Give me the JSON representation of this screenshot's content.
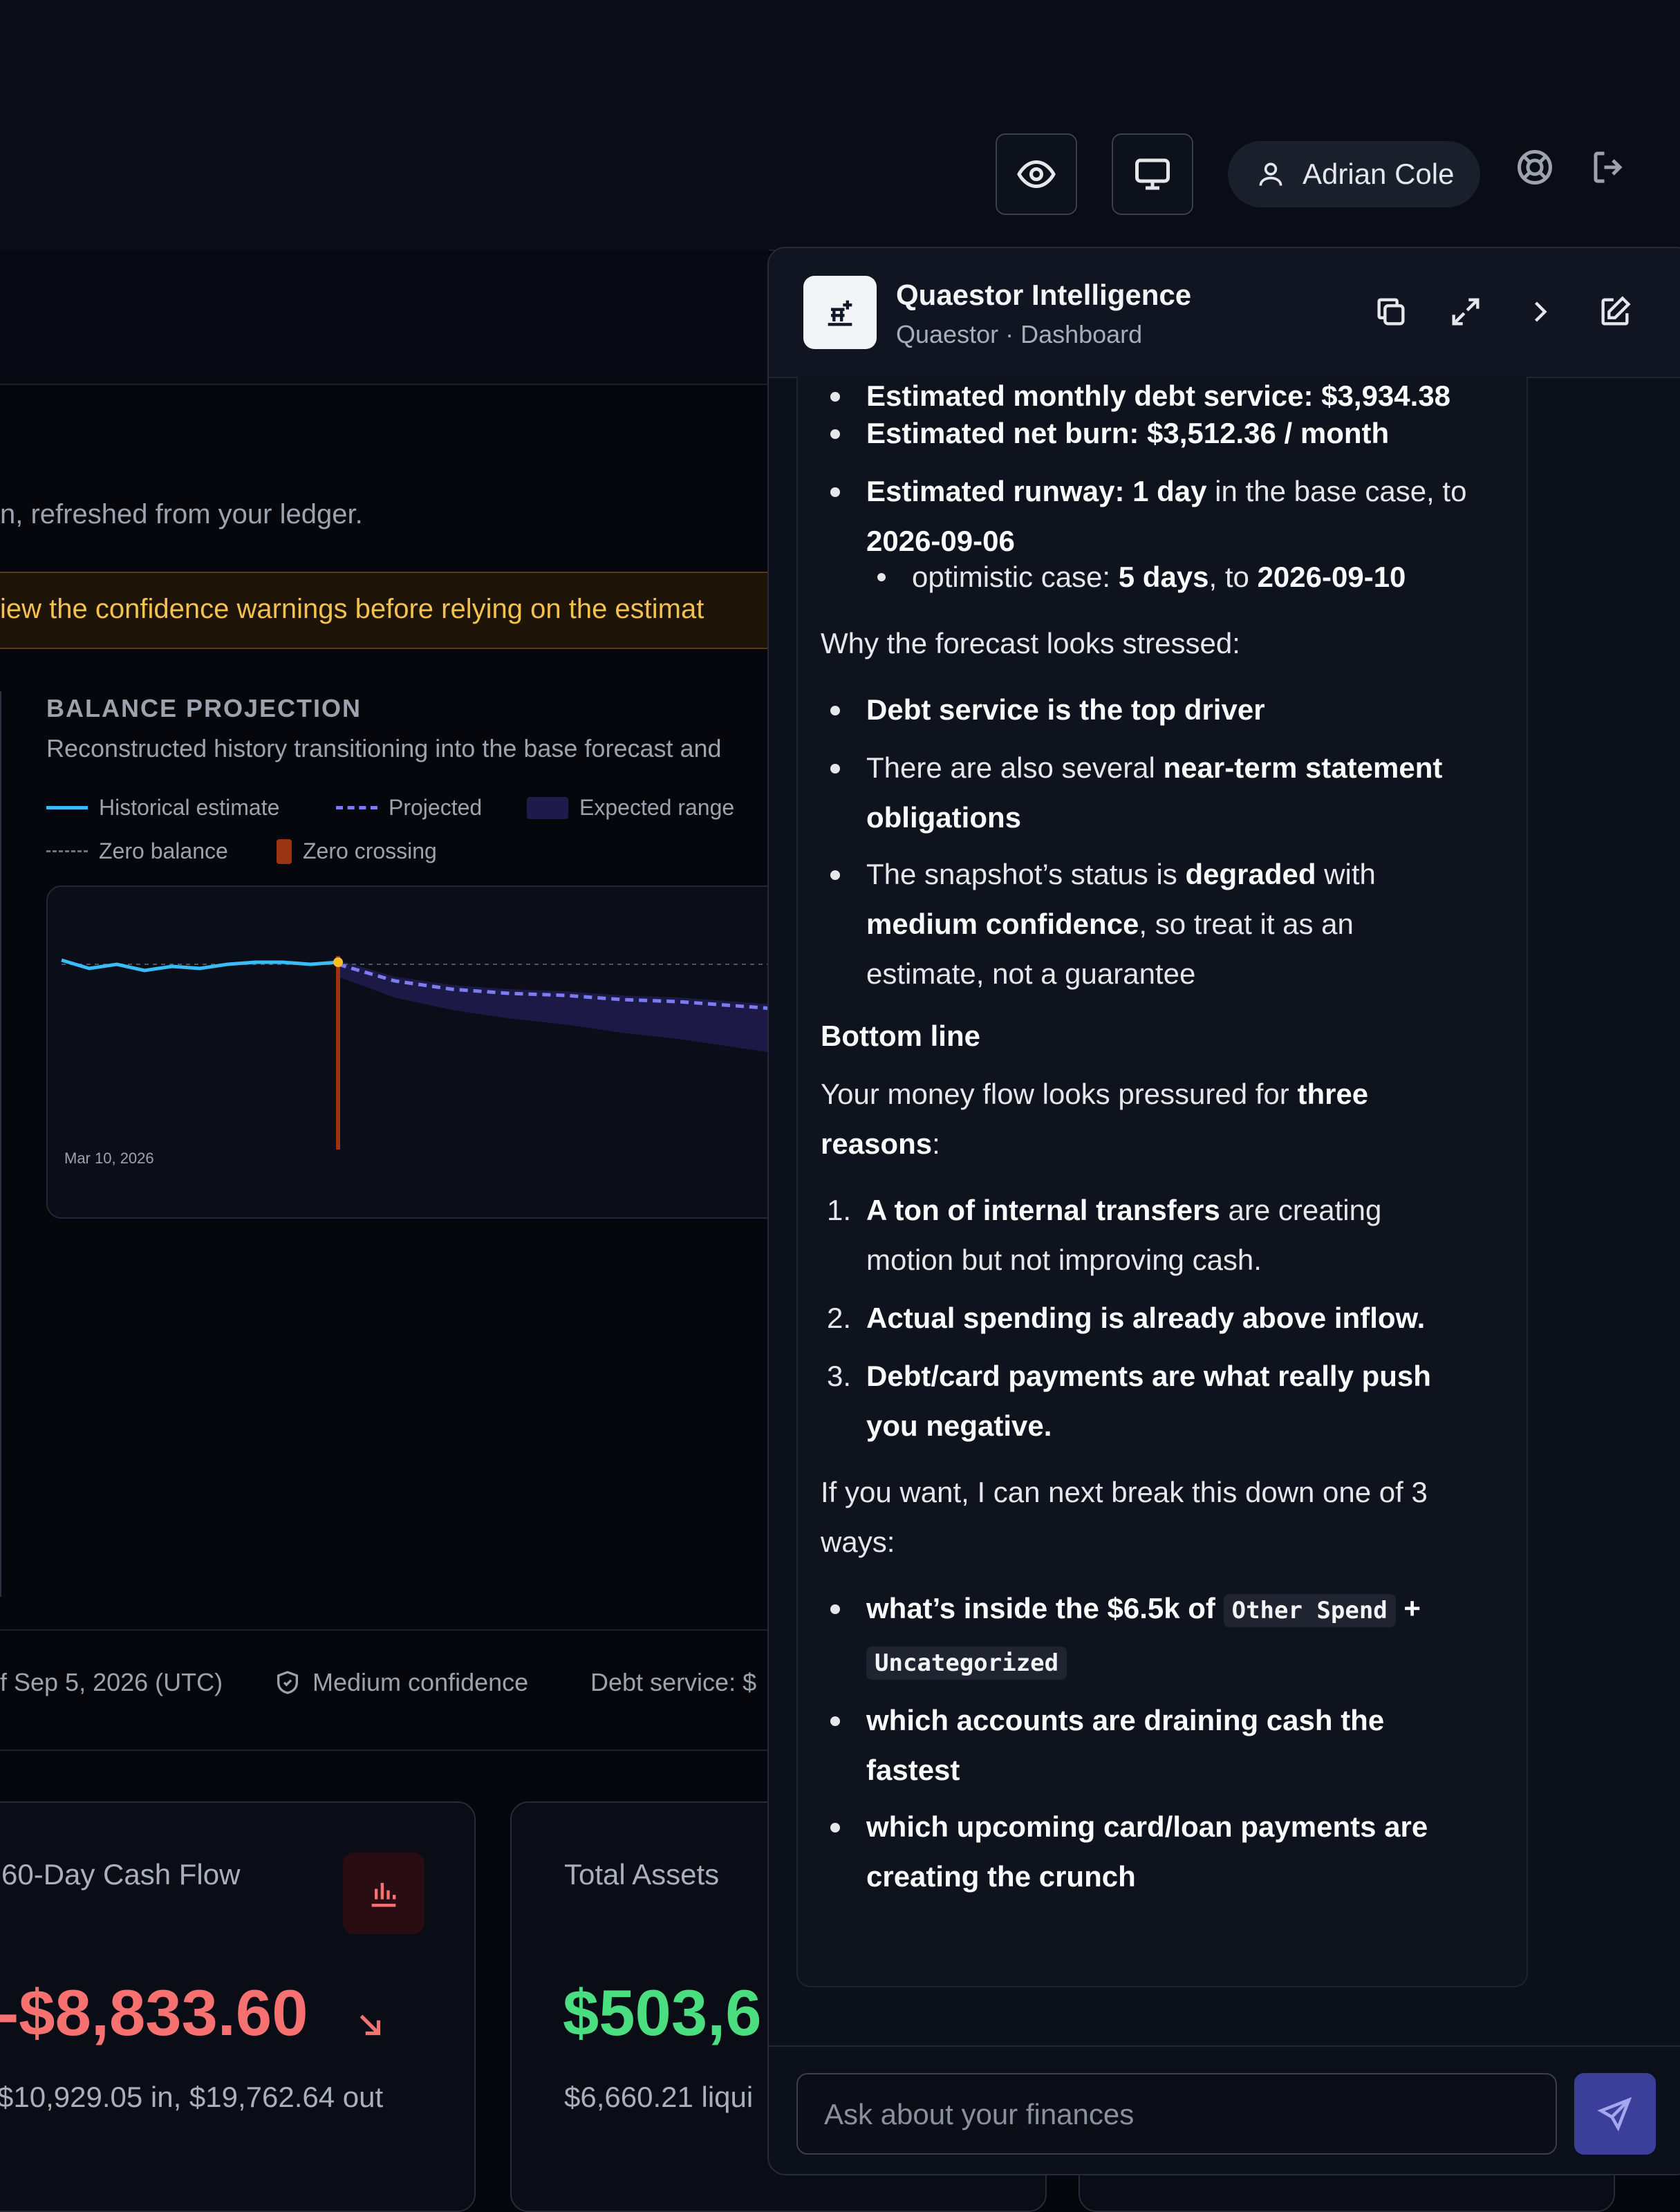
{
  "topbar": {
    "user_name": "Adrian Cole",
    "icons": [
      "eye-icon",
      "monitor-icon",
      "user-icon",
      "help-lifebuoy-icon",
      "logout-icon"
    ]
  },
  "dashboard": {
    "subtitle": "n, refreshed from your ledger.",
    "warning": "iew the confidence warnings before relying on the estimat",
    "chart": {
      "title": "BALANCE PROJECTION",
      "subtitle": "Reconstructed history transitioning into the base forecast and",
      "legend": {
        "historical": "Historical estimate",
        "projected": "Projected",
        "range": "Expected range",
        "zero": "Zero balance",
        "crossing": "Zero crossing"
      },
      "x_tick": "Mar 10, 2026"
    },
    "status": {
      "date": "f Sep 5, 2026 (UTC)",
      "confidence": "Medium confidence",
      "debt": "Debt service: $"
    },
    "cards": [
      {
        "title": "60-Day Cash Flow",
        "value": "-$8,833.60",
        "detail": "$10,929.05 in, $19,762.64 out"
      },
      {
        "title": "Total Assets",
        "value": "$503,6",
        "detail": "$6,660.21 liqui"
      }
    ]
  },
  "chart_data": {
    "type": "line",
    "title": "BALANCE PROJECTION",
    "x_tick_labels": [
      "Mar 10, 2026"
    ],
    "series": [
      {
        "name": "Historical estimate",
        "values": [
          1.0,
          0.96,
          0.98,
          0.95,
          0.97,
          0.96,
          0.98,
          0.99,
          0.99,
          0.98,
          0.99
        ]
      },
      {
        "name": "Projected",
        "values": [
          0.98,
          0.9,
          0.86,
          0.84,
          0.83,
          0.81,
          0.8,
          0.78,
          0.76,
          0.74,
          0.72
        ]
      }
    ],
    "colors": {
      "historical": "#38bdf8",
      "projected": "#7c7cf0",
      "range": "#1e1b4b",
      "crossing": "#9a3412"
    }
  },
  "chat": {
    "title": "Quaestor Intelligence",
    "context": "Quaestor · Dashboard",
    "lines": {
      "b1": "Estimated monthly debt service: $3,934.38",
      "b2": "Estimated net burn: $3,512.36 / month",
      "b3_label": "Estimated runway:",
      "b3_days": "1 day",
      "b3_mid": " in the base case, to",
      "b3_date": "2026-09-06",
      "sub_pre": "optimistic case: ",
      "sub_days": "5 days",
      "sub_mid": ", to ",
      "sub_date": "2026-09-10",
      "why": "Why the forecast looks stressed:",
      "w1": "Debt service is the top driver",
      "w2_pre": "There are also several ",
      "w2_bold1": "near-term statement",
      "w2_bold2": "obligations",
      "w3_pre": "The snapshot’s status is ",
      "w3_bold": "degraded",
      "w3_post": " with",
      "w3_bold2": "medium confidence",
      "w3_post2": ", so treat it as an",
      "w3_line3": "estimate, not a guarantee",
      "bottom": "Bottom line",
      "reasons_pre": "Your money flow looks pressured for ",
      "reasons_bold1": "three",
      "reasons_bold2": "reasons",
      "reasons_post": ":",
      "r1_bold": "A ton of internal transfers",
      "r1_post": " are creating",
      "r1_line2": "motion but not improving cash.",
      "r2": "Actual spending is already above inflow.",
      "r3_l1": "Debt/card payments are what really push",
      "r3_l2": "you negative.",
      "next_l1": "If you want, I can next break this down one of 3",
      "next_l2": "ways:",
      "o1_pre": "what’s inside the $6.5k of ",
      "o1_code1": "Other Spend",
      "o1_plus": " +",
      "o1_code2": "Uncategorized",
      "o2_l1": "which accounts are draining cash the",
      "o2_l2": "fastest",
      "o3_l1": "which upcoming card/loan payments are",
      "o3_l2": "creating the crunch"
    },
    "input_placeholder": "Ask about your finances"
  }
}
